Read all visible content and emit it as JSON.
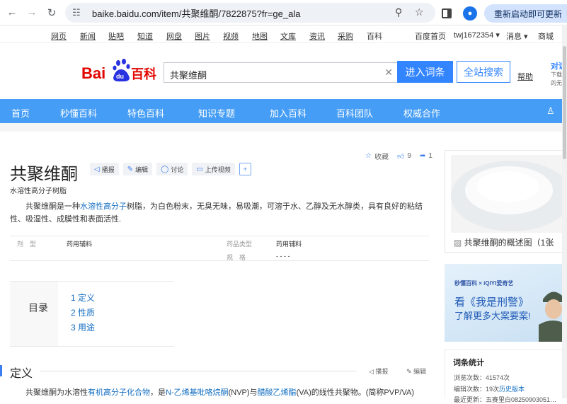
{
  "browser": {
    "url": "baike.baidu.com/item/共聚维酮/7822875?fr=ge_ala",
    "restart_label": "重新启动即可更新"
  },
  "toplinks": [
    "网页",
    "新闻",
    "贴吧",
    "知道",
    "网盘",
    "图片",
    "视频",
    "地图",
    "文库",
    "资讯",
    "采购",
    "百科"
  ],
  "toplinks_right": {
    "home": "百度首页",
    "user": "twj1672354 ▾",
    "msg": "消息 ▾",
    "mall": "商城"
  },
  "header": {
    "logo_text": "Bai du 百科",
    "search_value": "共聚维酮",
    "enter_button": "进入词条",
    "all_button": "全站搜索",
    "help": "帮助",
    "side_ad_title": "对话",
    "side_ad_sub1": "下载",
    "side_ad_sub2": "的无"
  },
  "nav": [
    "首页",
    "秒懂百科",
    "特色百科",
    "知识专题",
    "加入百科",
    "百科团队",
    "权威合作"
  ],
  "article": {
    "title": "共聚维酮",
    "subtitle": "水溶性高分子树脂",
    "tools": [
      "播报",
      "编辑",
      "讨论",
      "上传视频"
    ],
    "stats": {
      "fav": "收藏",
      "likes": "9",
      "shares": "1"
    },
    "summary_pre": "共聚维酮是一种",
    "summary_link": "水溶性高分子",
    "summary_post": "树脂，为白色粉末，无臭无味，易吸潮，可溶于水、乙醇及无水醇类，具有良好的粘结性、吸湿性、成膜性和表面活性.",
    "info": {
      "k1": "剂　型",
      "v1": "药用辅料",
      "k2": "药品类型",
      "v2": "药用辅料",
      "k3": "规　格",
      "v3": "- - - -"
    },
    "toc_label": "目录",
    "toc": [
      "1  定义",
      "2  性质",
      "3  用途"
    ],
    "section_title": "定义",
    "section_actions": [
      "播报",
      "编辑"
    ],
    "defn_a": "共聚维酮为水溶性",
    "defn_b": "有机高分子化合物",
    "defn_c": "，是",
    "defn_d": "N-乙烯基吡咯烷酮",
    "defn_e": "(NVP)与",
    "defn_f": "醋酸乙烯酯",
    "defn_g": "(VA)的线性共聚物。(简称PVP/VA)"
  },
  "right": {
    "album_caption": "共聚维酮的概述图（1张",
    "ad_brand": "秒懂百科 × iQIYI爱奇艺",
    "ad_line1": "看《我是刑警》",
    "ad_line2": "了解更多大案要案!",
    "stat_title": "词条统计",
    "stat_views": "浏览次数：41574次",
    "stat_edits_pre": "编辑次数：19次",
    "stat_edits_link": "历史版本",
    "stat_last": "最近更新：五赛里白08250903051…"
  },
  "colors": {
    "accent": "#3385ff",
    "nav": "#459df5",
    "link": "#136ec2"
  }
}
